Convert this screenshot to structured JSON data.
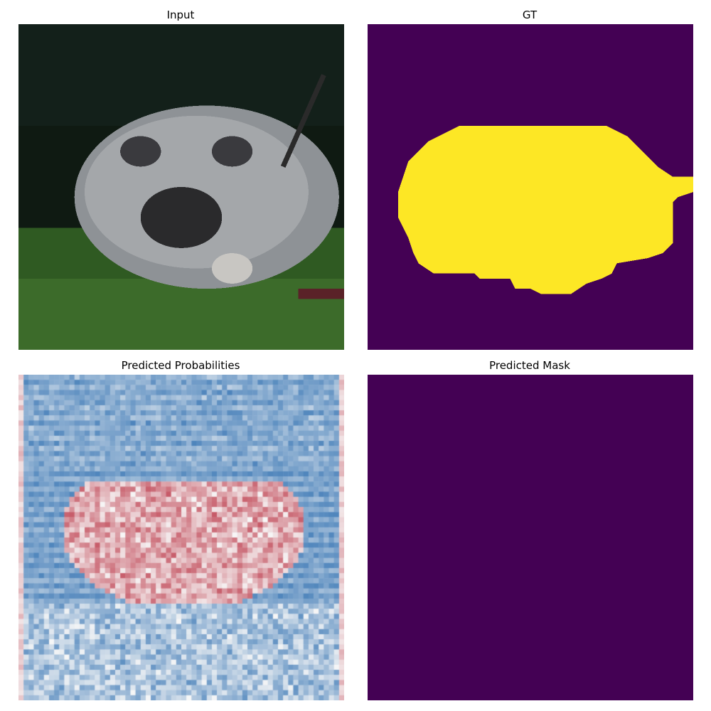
{
  "panels": {
    "input": {
      "title": "Input"
    },
    "gt": {
      "title": "GT"
    },
    "prob": {
      "title": "Predicted Probabilities"
    },
    "mask": {
      "title": "Predicted Mask"
    }
  },
  "colors": {
    "mask_background": "#440154",
    "mask_foreground": "#fde725",
    "prob_low": "#2166ac",
    "prob_mid": "#f7f7f7",
    "prob_high": "#b2182b",
    "input_dark": "#0f1a12",
    "input_grass": "#3f7a2a",
    "input_fur": "#9a9ea2"
  }
}
